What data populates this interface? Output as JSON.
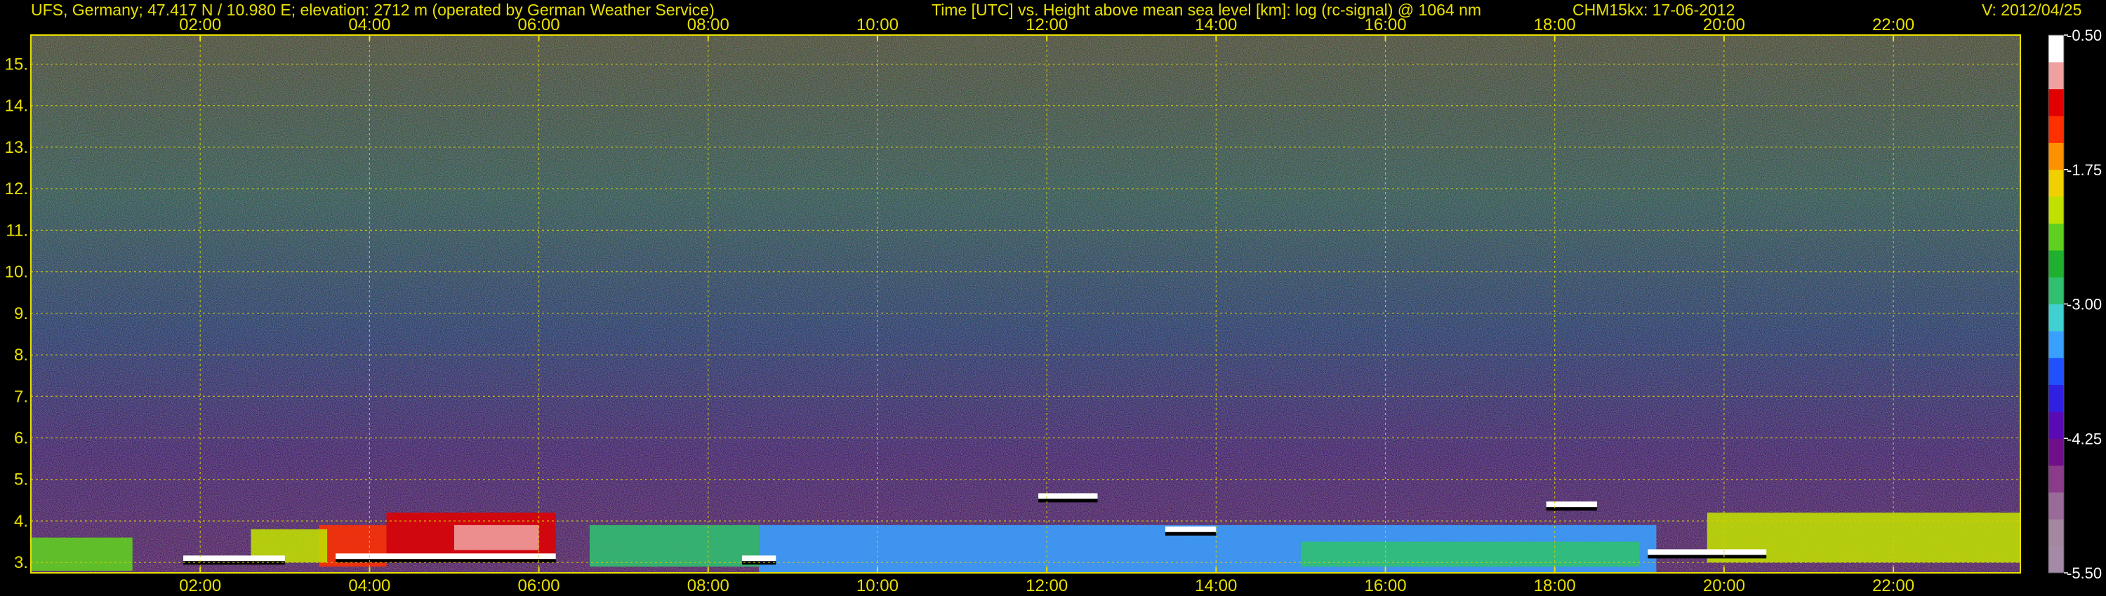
{
  "header": {
    "site": "UFS, Germany; 47.417 N / 10.980 E; elevation: 2712 m  (operated by German Weather Service)",
    "title": "Time [UTC] vs. Height above mean sea level [km]: log (rc-signal) @ 1064 nm",
    "instrument_date": "CHM15kx: 17-06-2012",
    "version": "V: 2012/04/25"
  },
  "chart_data": {
    "type": "heatmap",
    "title": "Time [UTC] vs. Height above mean sea level [km]: log (rc-signal) @ 1064 nm",
    "x_ticks": [
      "02:00",
      "04:00",
      "06:00",
      "08:00",
      "10:00",
      "12:00",
      "14:00",
      "16:00",
      "18:00",
      "20:00",
      "22:00"
    ],
    "x_tick_hours": [
      2,
      4,
      6,
      8,
      10,
      12,
      14,
      16,
      18,
      20,
      22
    ],
    "xlim_hours": [
      0,
      23.5
    ],
    "y_ticks": [
      3,
      4,
      5,
      6,
      7,
      8,
      9,
      10,
      11,
      12,
      13,
      14,
      15
    ],
    "ylim": [
      2.75,
      15.7
    ],
    "grid": true,
    "colorbar": {
      "ticks": [
        "-0.50",
        "-1.75",
        "-3.00",
        "-4.25",
        "-5.50"
      ],
      "tick_values": [
        -0.5,
        -1.75,
        -3.0,
        -4.25,
        -5.5
      ],
      "range": [
        -5.5,
        -0.5
      ],
      "colors": [
        "#a58aa8",
        "#a3879f",
        "#9a6a98",
        "#8a3c8a",
        "#6f0f8a",
        "#5a0ab4",
        "#3020e0",
        "#2050ff",
        "#3aa0ff",
        "#40d0d0",
        "#30c070",
        "#20b030",
        "#60d020",
        "#c0e000",
        "#f0d000",
        "#ff9000",
        "#ff3000",
        "#e00000",
        "#f0a0a0",
        "#ffffff"
      ]
    },
    "regions": [
      {
        "t0": 0.0,
        "t1": 1.2,
        "h0": 2.8,
        "h1": 3.6,
        "value": -2.4
      },
      {
        "t0": 3.4,
        "t1": 4.2,
        "h0": 2.9,
        "h1": 3.9,
        "value": -1.5
      },
      {
        "t0": 4.2,
        "t1": 6.2,
        "h0": 3.0,
        "h1": 4.2,
        "value": -1.2
      },
      {
        "t0": 5.0,
        "t1": 6.0,
        "h0": 3.3,
        "h1": 3.9,
        "value": -0.8
      },
      {
        "t0": 2.6,
        "t1": 3.5,
        "h0": 3.0,
        "h1": 3.8,
        "value": -2.2
      },
      {
        "t0": 6.6,
        "t1": 8.6,
        "h0": 2.9,
        "h1": 3.9,
        "value": -2.9
      },
      {
        "t0": 8.6,
        "t1": 19.2,
        "h0": 2.75,
        "h1": 3.9,
        "value": -3.5
      },
      {
        "t0": 15.0,
        "t1": 19.0,
        "h0": 2.9,
        "h1": 3.5,
        "value": -2.8
      },
      {
        "t0": 19.8,
        "t1": 23.5,
        "h0": 3.0,
        "h1": 4.2,
        "value": -2.1
      }
    ],
    "cloud_layers": [
      {
        "t0": 11.9,
        "t1": 12.6,
        "h": 4.6
      },
      {
        "t0": 13.4,
        "t1": 14.0,
        "h": 3.8
      },
      {
        "t0": 17.9,
        "t1": 18.5,
        "h": 4.4
      },
      {
        "t0": 1.8,
        "t1": 3.0,
        "h": 3.1
      },
      {
        "t0": 3.6,
        "t1": 6.2,
        "h": 3.15
      },
      {
        "t0": 8.4,
        "t1": 8.8,
        "h": 3.1
      },
      {
        "t0": 19.1,
        "t1": 20.5,
        "h": 3.25
      }
    ]
  }
}
